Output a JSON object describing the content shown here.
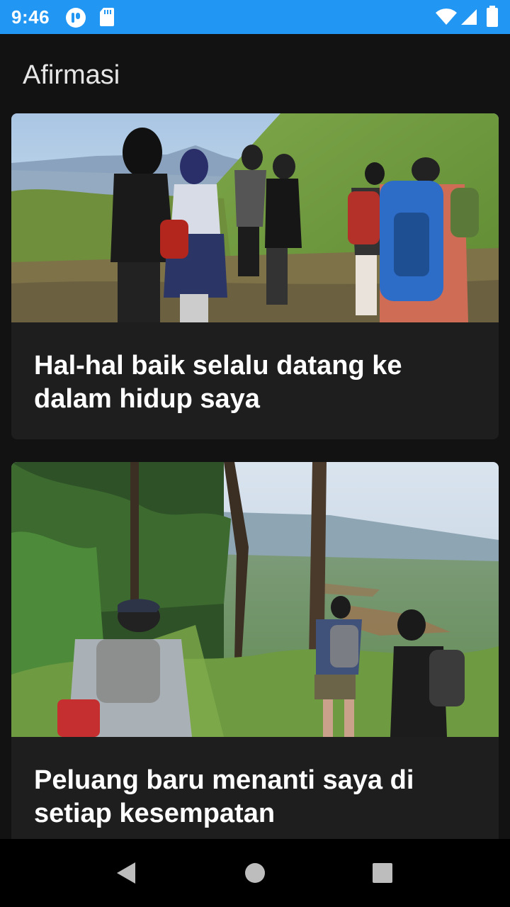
{
  "status_bar": {
    "time": "9:46",
    "icons": [
      "app-notification-icon",
      "sd-card-icon",
      "wifi-icon",
      "signal-icon",
      "battery-icon"
    ]
  },
  "app_bar": {
    "title": "Afirmasi"
  },
  "cards": [
    {
      "title": "Hal-hal baik selalu datang ke dalam hidup saya",
      "image": "hikers-on-grassy-ridge-photo"
    },
    {
      "title": "Peluang baru menanti saya di setiap kesempatan",
      "image": "hikers-in-pine-forest-overlooking-valley-photo"
    }
  ],
  "nav_bar": {
    "icons": [
      "back-icon",
      "home-icon",
      "recents-icon"
    ]
  },
  "colors": {
    "status_bar": "#2196f3",
    "background": "#121212",
    "card": "#1e1e1e",
    "text": "#ffffff"
  }
}
